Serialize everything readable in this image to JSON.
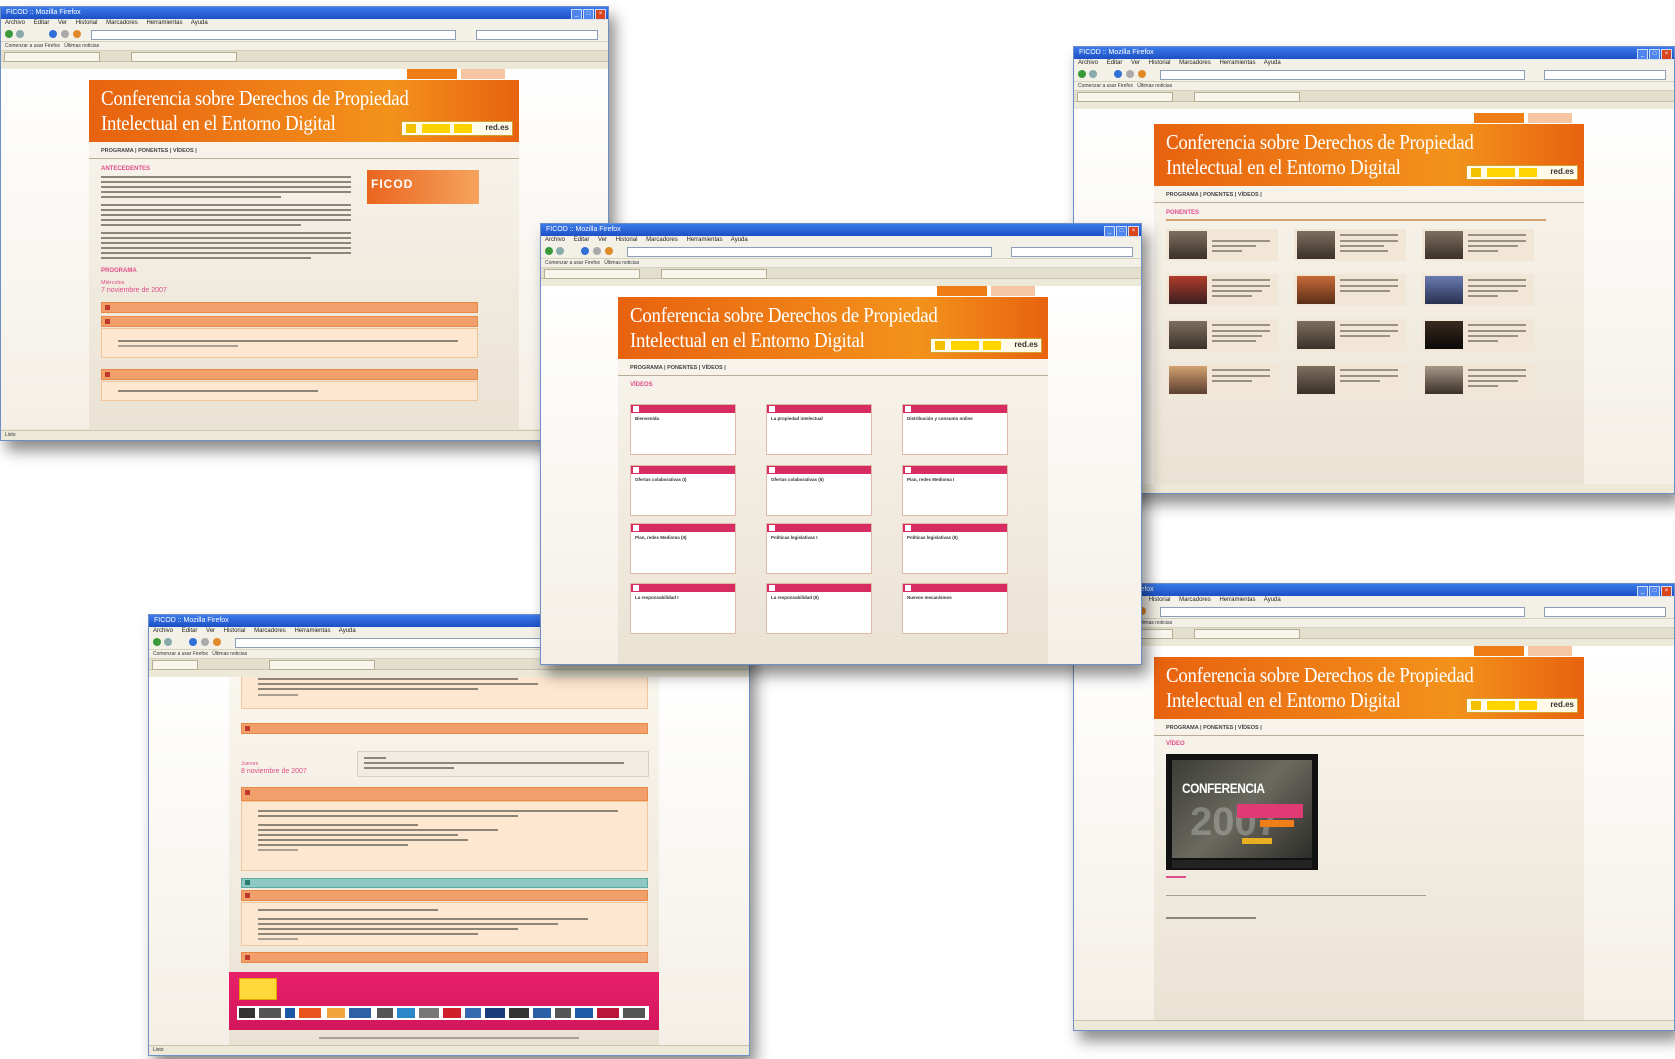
{
  "browser": {
    "title": "FICOD :: Mozilla Firefox",
    "menu": [
      "Archivo",
      "Editar",
      "Ver",
      "Historial",
      "Marcadores",
      "Herramientas",
      "Ayuda"
    ],
    "bookmarks": [
      "Comenzar a usar Firefox",
      "Últimas noticias"
    ],
    "status": "Listo"
  },
  "site": {
    "title_line1": "Conferencia sobre Derechos de Propiedad",
    "title_line2": "Intelectual en el Entorno Digital",
    "brand": "red.es",
    "nav": "PROGRAMA  |  PONENTES  |  VÍDEOS  |"
  },
  "win1": {
    "section1": "ANTECEDENTES",
    "section2": "PROGRAMA",
    "day": "Miércoles",
    "date": "7 noviembre de 2007",
    "ficod": "FICOD"
  },
  "win2": {
    "section": "VÍDEOS",
    "cards": [
      {
        "label": "Bienvenida"
      },
      {
        "label": "La propiedad intelectual"
      },
      {
        "label": "Distribución y consumo online"
      },
      {
        "label": "Ofertas colaborativas (I)"
      },
      {
        "label": "Ofertas colaborativas (II)"
      },
      {
        "label": "Plan, redes Medioma I"
      },
      {
        "label": "Plan, redes Medioma (II)"
      },
      {
        "label": "Políticas legislativas I"
      },
      {
        "label": "Políticas legislativas (II)"
      },
      {
        "label": "La responsabilidad I"
      },
      {
        "label": "La responsabilidad (II)"
      },
      {
        "label": "Nuevos mecanismos"
      }
    ]
  },
  "win3": {
    "section": "PONENTES"
  },
  "win4": {
    "day": "Jueves",
    "date": "8 noviembre de 2007"
  },
  "win5": {
    "section": "VÍDEO",
    "video_title": "CONFERENCIA"
  }
}
